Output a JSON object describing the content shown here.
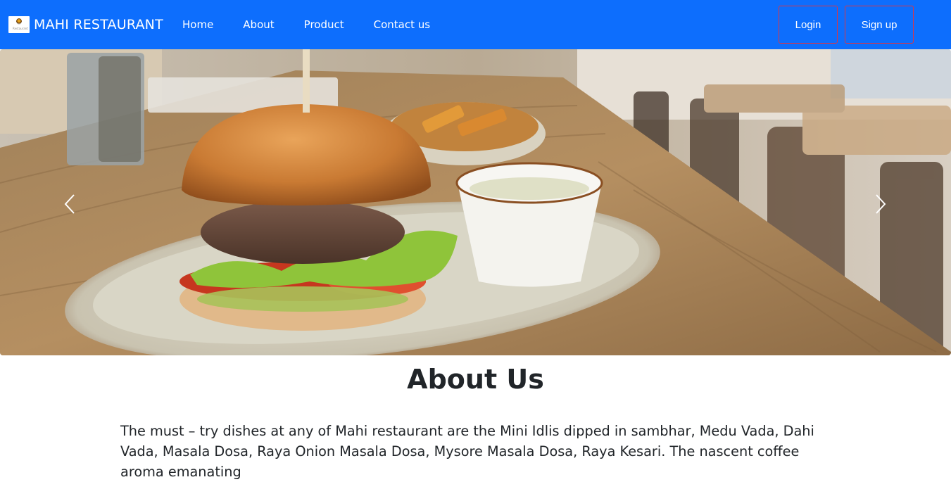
{
  "navbar": {
    "brand": "MAHI RESTAURANT",
    "logo_text": "Restaurant",
    "links": [
      "Home",
      "About",
      "Product",
      "Contact us"
    ],
    "login": "Login",
    "signup": "Sign up"
  },
  "carousel": {
    "prev_icon": "chevron-left-icon",
    "next_icon": "chevron-right-icon"
  },
  "about": {
    "title": "About Us",
    "text": "The must – try dishes at any of Mahi restaurant are the Mini Idlis dipped in sambhar, Medu Vada, Dahi Vada, Masala Dosa, Raya Onion Masala Dosa, Mysore Masala Dosa, Raya Kesari. The nascent coffee aroma emanating"
  },
  "colors": {
    "navbar": "#0d6efd",
    "auth_border": "#dc3545",
    "text": "#212529"
  }
}
